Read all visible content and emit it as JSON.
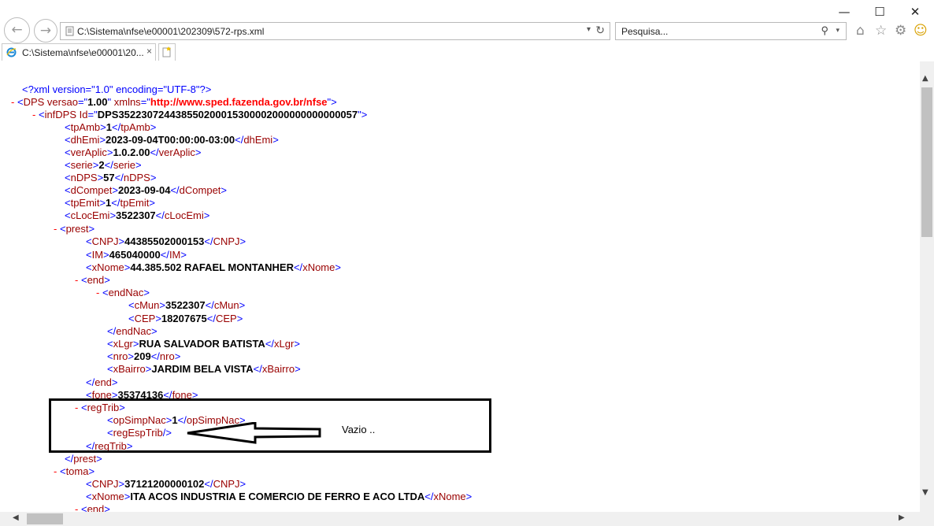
{
  "window": {
    "minimize": "—",
    "maximize": "☐",
    "close": "✕"
  },
  "nav": {
    "back": "←",
    "forward": "→"
  },
  "address": {
    "url": "C:\\Sistema\\nfse\\e00001\\202309\\572-rps.xml",
    "dropdown": "▾",
    "refresh": "↻"
  },
  "search": {
    "placeholder": "Pesquisa...",
    "icon": "⚲",
    "dropdown": "▾"
  },
  "toolbar": {
    "home": "⌂",
    "favorites": "☆",
    "settings": "⚙",
    "feedback": "☺"
  },
  "tab": {
    "title": "C:\\Sistema\\nfse\\e00001\\20...",
    "close": "×"
  },
  "xml": {
    "decl": "<?xml version=\"1.0\" encoding=\"UTF-8\"?>",
    "dps_open": "DPS",
    "dps_attr1_name": "versao",
    "dps_attr1_val": "1.00",
    "dps_attr2_name": "xmlns",
    "dps_attr2_val": "http://www.sped.fazenda.gov.br/nfse",
    "infdps_tag": "infDPS",
    "infdps_attr_name": "Id",
    "infdps_attr_val": "DPS352230724438550200015300002000000000000057",
    "tpAmb": "1",
    "dhEmi": "2023-09-04T00:00:00-03:00",
    "verAplic": "1.0.2.00",
    "serie": "2",
    "nDPS": "57",
    "dCompet": "2023-09-04",
    "tpEmit": "1",
    "cLocEmi": "3522307",
    "prest_CNPJ": "44385502000153",
    "prest_IM": "465040000",
    "prest_xNome": "44.385.502 RAFAEL MONTANHER",
    "cMun": "3522307",
    "CEP": "18207675",
    "xLgr": "RUA SALVADOR BATISTA",
    "nro": "209",
    "xBairro": "JARDIM BELA VISTA",
    "fone": "35374136",
    "opSimpNac": "1",
    "toma_CNPJ": "37121200000102",
    "toma_xNome": "ITA ACOS INDUSTRIA E COMERCIO DE FERRO E ACO LTDA"
  },
  "annotation": {
    "text": "Vazio .."
  },
  "colors": {
    "markup": "#0000ff",
    "tag": "#990000",
    "value": "#000000",
    "minus": "#ff0000"
  }
}
